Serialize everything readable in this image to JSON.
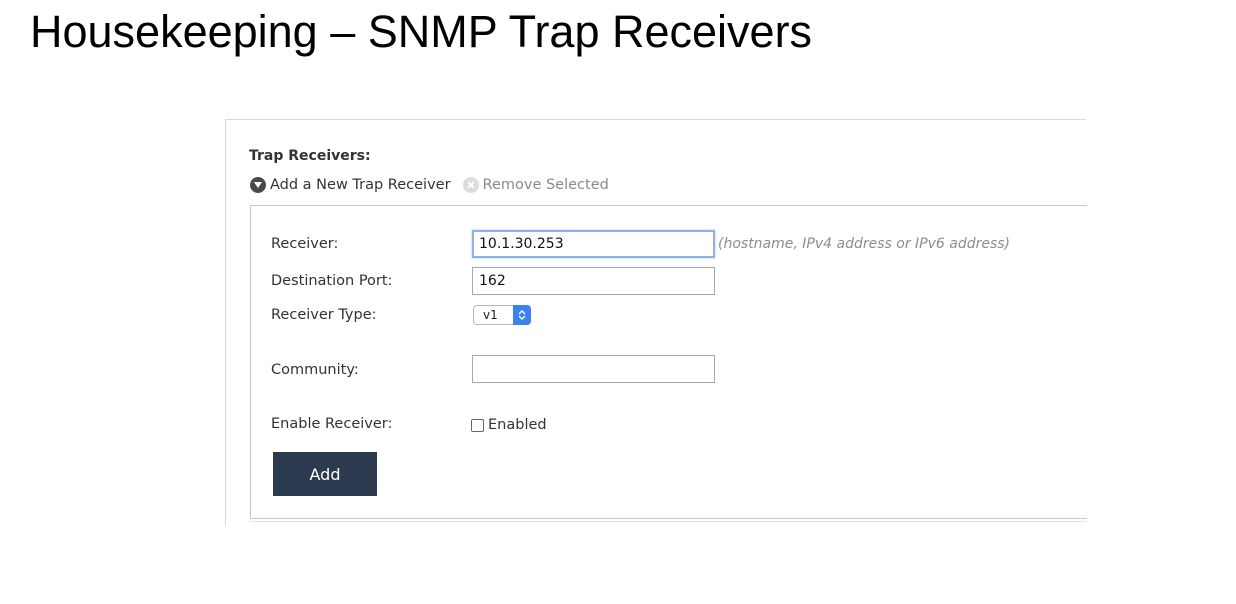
{
  "slide": {
    "title": "Housekeeping – SNMP Trap Receivers"
  },
  "panel": {
    "section_label": "Trap Receivers:",
    "actions": {
      "add_label": "Add a New Trap Receiver",
      "remove_label": "Remove Selected"
    },
    "form": {
      "receiver_label": "Receiver:",
      "receiver_value": "10.1.30.253",
      "receiver_hint": "(hostname, IPv4 address or IPv6 address)",
      "port_label": "Destination Port:",
      "port_value": "162",
      "type_label": "Receiver Type:",
      "type_value": "v1",
      "community_label": "Community:",
      "community_value": "",
      "enable_label": "Enable Receiver:",
      "enabled_label": "Enabled",
      "enabled_checked": false,
      "add_button": "Add"
    }
  },
  "colors": {
    "button_bg": "#2c3a50",
    "select_arrow": "#3b82f0",
    "focus_border": "#8fb4e3"
  },
  "icons": {
    "add_action": "chevron-down-circle-icon",
    "remove_action": "close-circle-icon",
    "select_arrow": "updown-arrows-icon"
  }
}
